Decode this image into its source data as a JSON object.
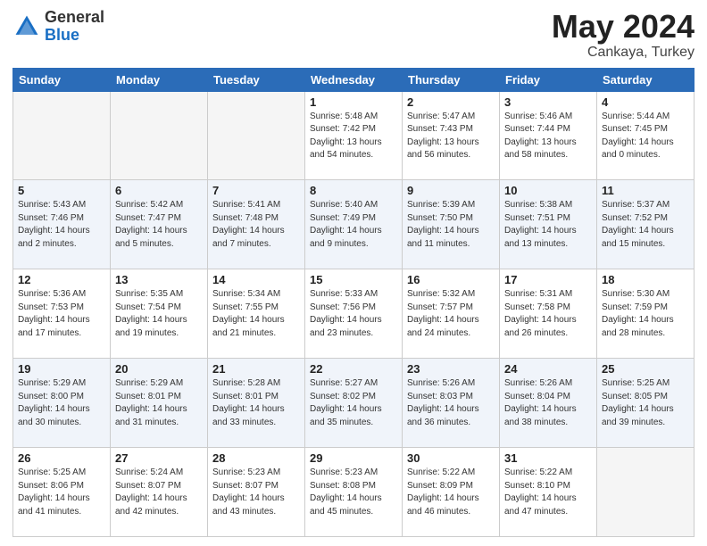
{
  "header": {
    "logo_general": "General",
    "logo_blue": "Blue",
    "title": "May 2024",
    "location": "Cankaya, Turkey"
  },
  "days_of_week": [
    "Sunday",
    "Monday",
    "Tuesday",
    "Wednesday",
    "Thursday",
    "Friday",
    "Saturday"
  ],
  "weeks": [
    [
      {
        "day": "",
        "info": ""
      },
      {
        "day": "",
        "info": ""
      },
      {
        "day": "",
        "info": ""
      },
      {
        "day": "1",
        "info": "Sunrise: 5:48 AM\nSunset: 7:42 PM\nDaylight: 13 hours\nand 54 minutes."
      },
      {
        "day": "2",
        "info": "Sunrise: 5:47 AM\nSunset: 7:43 PM\nDaylight: 13 hours\nand 56 minutes."
      },
      {
        "day": "3",
        "info": "Sunrise: 5:46 AM\nSunset: 7:44 PM\nDaylight: 13 hours\nand 58 minutes."
      },
      {
        "day": "4",
        "info": "Sunrise: 5:44 AM\nSunset: 7:45 PM\nDaylight: 14 hours\nand 0 minutes."
      }
    ],
    [
      {
        "day": "5",
        "info": "Sunrise: 5:43 AM\nSunset: 7:46 PM\nDaylight: 14 hours\nand 2 minutes."
      },
      {
        "day": "6",
        "info": "Sunrise: 5:42 AM\nSunset: 7:47 PM\nDaylight: 14 hours\nand 5 minutes."
      },
      {
        "day": "7",
        "info": "Sunrise: 5:41 AM\nSunset: 7:48 PM\nDaylight: 14 hours\nand 7 minutes."
      },
      {
        "day": "8",
        "info": "Sunrise: 5:40 AM\nSunset: 7:49 PM\nDaylight: 14 hours\nand 9 minutes."
      },
      {
        "day": "9",
        "info": "Sunrise: 5:39 AM\nSunset: 7:50 PM\nDaylight: 14 hours\nand 11 minutes."
      },
      {
        "day": "10",
        "info": "Sunrise: 5:38 AM\nSunset: 7:51 PM\nDaylight: 14 hours\nand 13 minutes."
      },
      {
        "day": "11",
        "info": "Sunrise: 5:37 AM\nSunset: 7:52 PM\nDaylight: 14 hours\nand 15 minutes."
      }
    ],
    [
      {
        "day": "12",
        "info": "Sunrise: 5:36 AM\nSunset: 7:53 PM\nDaylight: 14 hours\nand 17 minutes."
      },
      {
        "day": "13",
        "info": "Sunrise: 5:35 AM\nSunset: 7:54 PM\nDaylight: 14 hours\nand 19 minutes."
      },
      {
        "day": "14",
        "info": "Sunrise: 5:34 AM\nSunset: 7:55 PM\nDaylight: 14 hours\nand 21 minutes."
      },
      {
        "day": "15",
        "info": "Sunrise: 5:33 AM\nSunset: 7:56 PM\nDaylight: 14 hours\nand 23 minutes."
      },
      {
        "day": "16",
        "info": "Sunrise: 5:32 AM\nSunset: 7:57 PM\nDaylight: 14 hours\nand 24 minutes."
      },
      {
        "day": "17",
        "info": "Sunrise: 5:31 AM\nSunset: 7:58 PM\nDaylight: 14 hours\nand 26 minutes."
      },
      {
        "day": "18",
        "info": "Sunrise: 5:30 AM\nSunset: 7:59 PM\nDaylight: 14 hours\nand 28 minutes."
      }
    ],
    [
      {
        "day": "19",
        "info": "Sunrise: 5:29 AM\nSunset: 8:00 PM\nDaylight: 14 hours\nand 30 minutes."
      },
      {
        "day": "20",
        "info": "Sunrise: 5:29 AM\nSunset: 8:01 PM\nDaylight: 14 hours\nand 31 minutes."
      },
      {
        "day": "21",
        "info": "Sunrise: 5:28 AM\nSunset: 8:01 PM\nDaylight: 14 hours\nand 33 minutes."
      },
      {
        "day": "22",
        "info": "Sunrise: 5:27 AM\nSunset: 8:02 PM\nDaylight: 14 hours\nand 35 minutes."
      },
      {
        "day": "23",
        "info": "Sunrise: 5:26 AM\nSunset: 8:03 PM\nDaylight: 14 hours\nand 36 minutes."
      },
      {
        "day": "24",
        "info": "Sunrise: 5:26 AM\nSunset: 8:04 PM\nDaylight: 14 hours\nand 38 minutes."
      },
      {
        "day": "25",
        "info": "Sunrise: 5:25 AM\nSunset: 8:05 PM\nDaylight: 14 hours\nand 39 minutes."
      }
    ],
    [
      {
        "day": "26",
        "info": "Sunrise: 5:25 AM\nSunset: 8:06 PM\nDaylight: 14 hours\nand 41 minutes."
      },
      {
        "day": "27",
        "info": "Sunrise: 5:24 AM\nSunset: 8:07 PM\nDaylight: 14 hours\nand 42 minutes."
      },
      {
        "day": "28",
        "info": "Sunrise: 5:23 AM\nSunset: 8:07 PM\nDaylight: 14 hours\nand 43 minutes."
      },
      {
        "day": "29",
        "info": "Sunrise: 5:23 AM\nSunset: 8:08 PM\nDaylight: 14 hours\nand 45 minutes."
      },
      {
        "day": "30",
        "info": "Sunrise: 5:22 AM\nSunset: 8:09 PM\nDaylight: 14 hours\nand 46 minutes."
      },
      {
        "day": "31",
        "info": "Sunrise: 5:22 AM\nSunset: 8:10 PM\nDaylight: 14 hours\nand 47 minutes."
      },
      {
        "day": "",
        "info": ""
      }
    ]
  ]
}
